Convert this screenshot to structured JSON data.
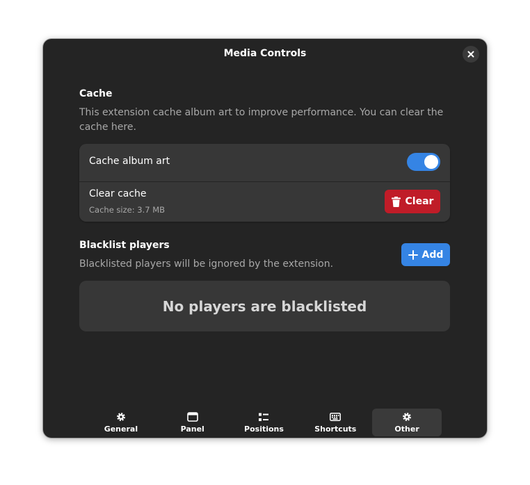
{
  "window": {
    "title": "Media Controls"
  },
  "cache": {
    "title": "Cache",
    "description_line1": "This extension cache album art to improve performance. You can clear the",
    "description_line2": "cache here.",
    "album_art_label": "Cache album art",
    "album_art_enabled": true,
    "clear_title": "Clear cache",
    "cache_size": "Cache size: 3.7 MB",
    "clear_button": "Clear"
  },
  "blacklist": {
    "title": "Blacklist players",
    "description": "Blacklisted players will be ignored by the extension.",
    "add_button": "Add",
    "empty_text": "No players are blacklisted"
  },
  "tabs": [
    {
      "label": "General",
      "icon": "gear-icon",
      "active": false
    },
    {
      "label": "Panel",
      "icon": "panel-icon",
      "active": false
    },
    {
      "label": "Positions",
      "icon": "positions-icon",
      "active": false
    },
    {
      "label": "Shortcuts",
      "icon": "keyboard-icon",
      "active": false
    },
    {
      "label": "Other",
      "icon": "gear-icon",
      "active": true
    }
  ],
  "colors": {
    "accent": "#3584e4",
    "destructive": "#c01c28",
    "window_bg": "#242424",
    "card_bg": "#373737"
  }
}
